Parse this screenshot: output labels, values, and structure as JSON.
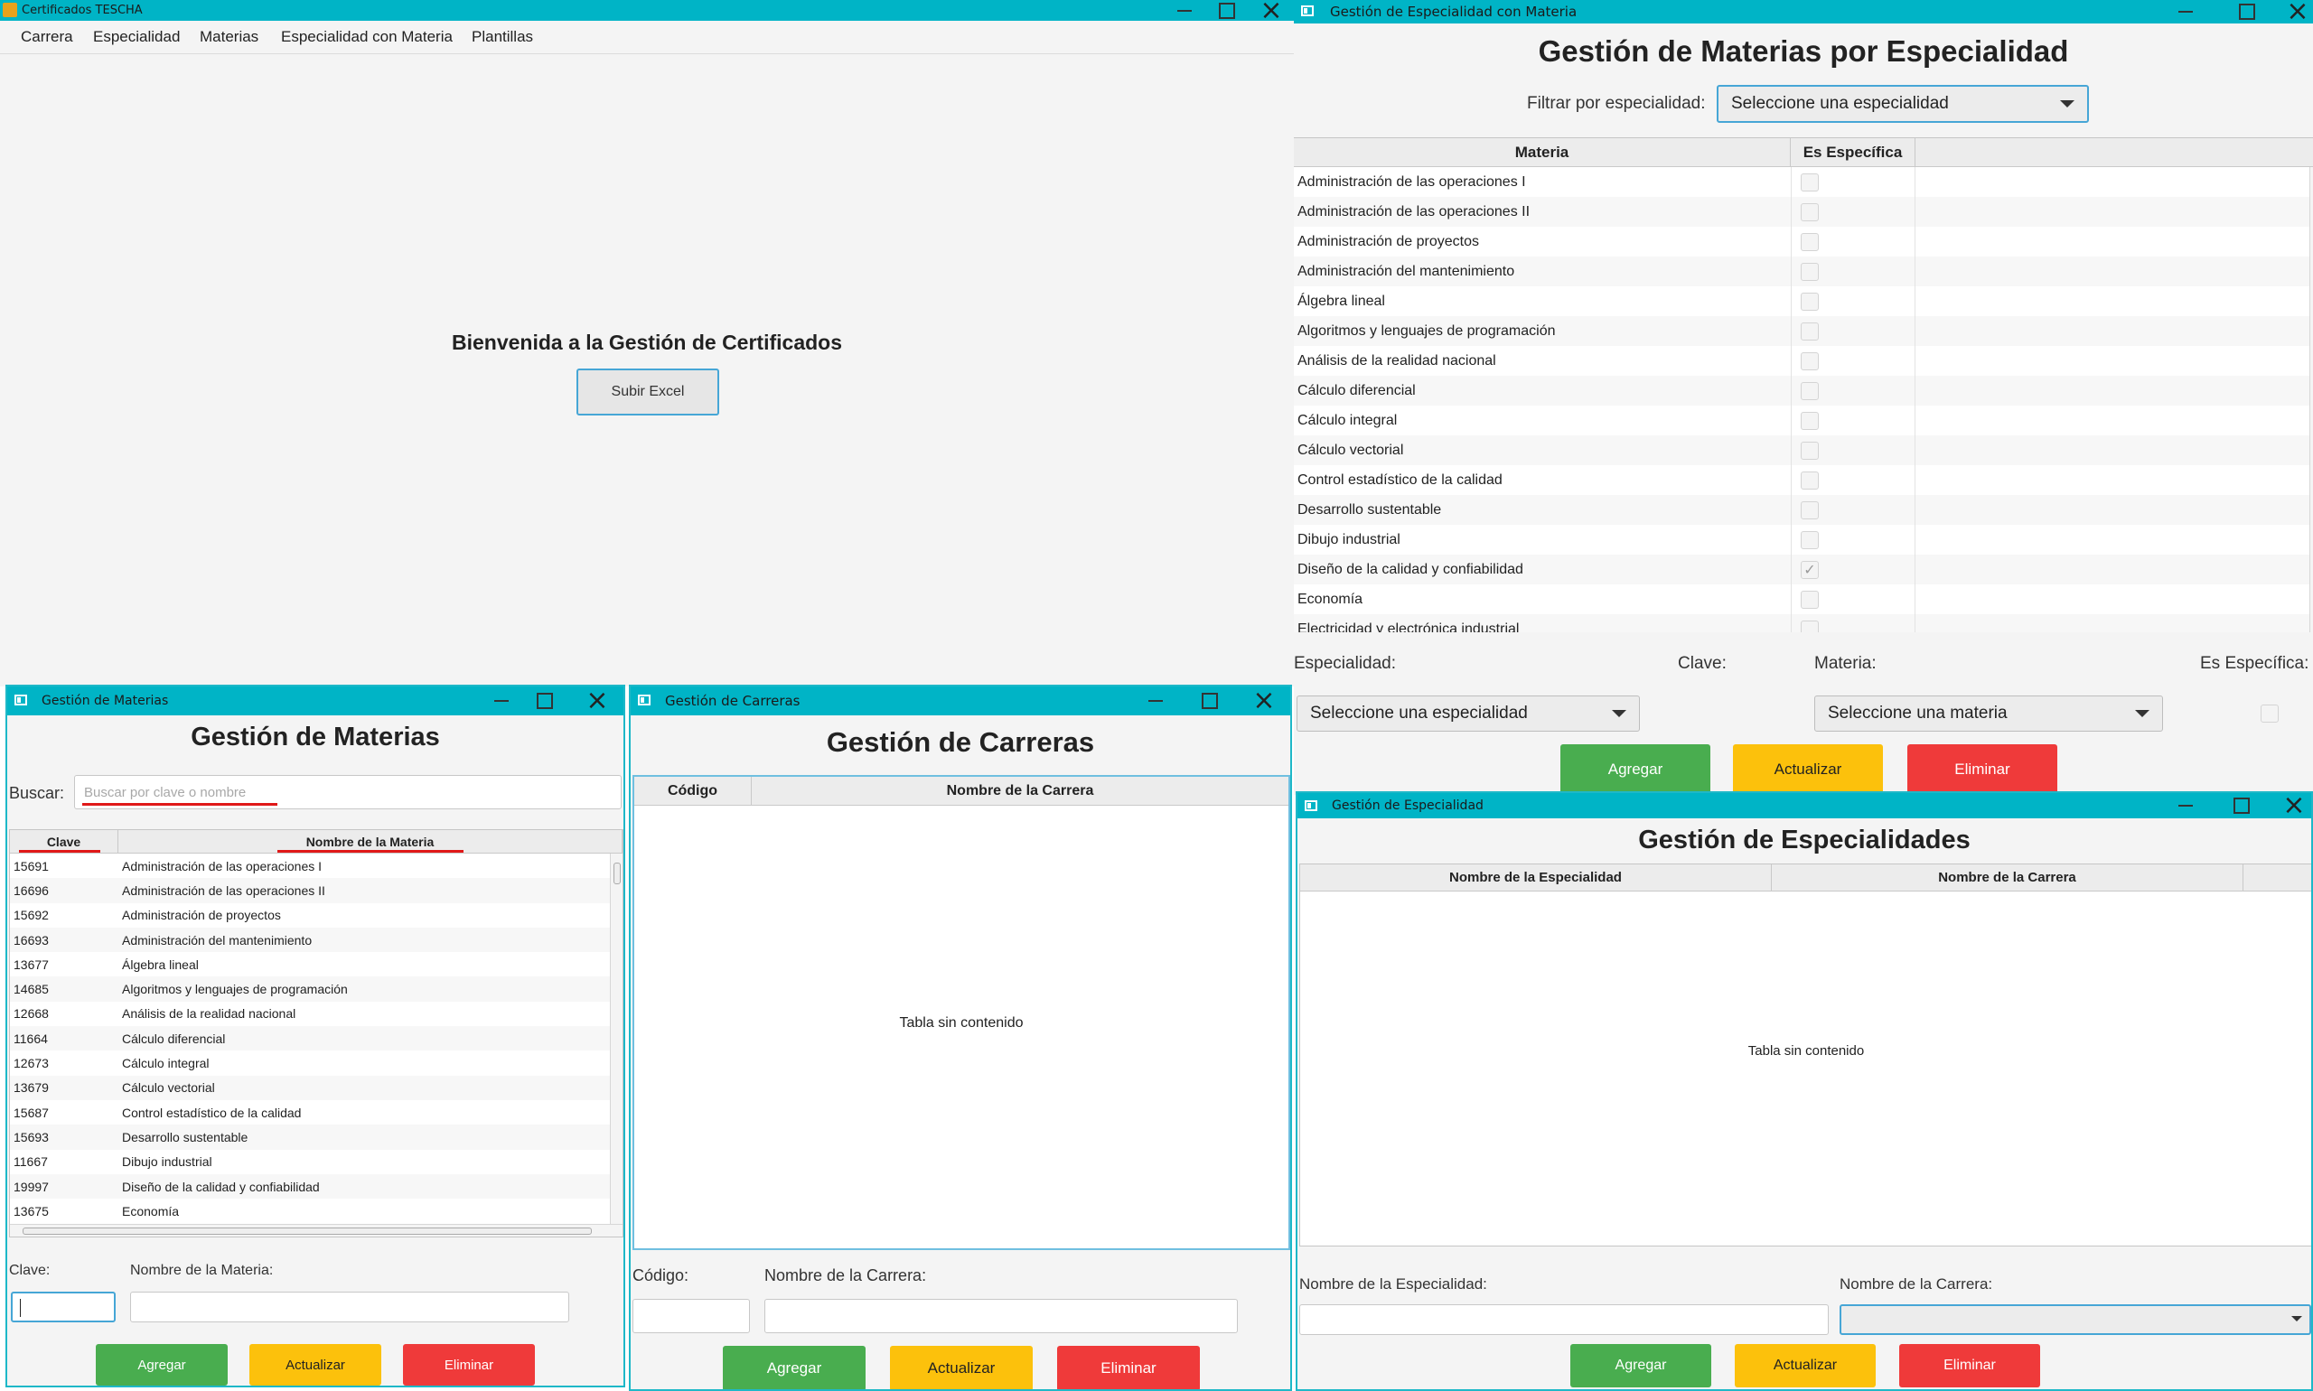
{
  "main": {
    "title": "Certificados TESCHA",
    "menu": [
      "Carrera",
      "Especialidad",
      "Materias",
      "Especialidad con Materia",
      "Plantillas"
    ],
    "welcome": "Bienvenida a la Gestión de Certificados",
    "upload_btn": "Subir Excel"
  },
  "esp_mat": {
    "title": "Gestión de Especialidad con Materia",
    "heading": "Gestión de Materias por Especialidad",
    "filter_label": "Filtrar por especialidad:",
    "filter_value": "Seleccione una especialidad",
    "columns": [
      "Materia",
      "Es Específica"
    ],
    "rows": [
      {
        "materia": "Administración de las operaciones I",
        "checked": false
      },
      {
        "materia": "Administración de las operaciones II",
        "checked": false
      },
      {
        "materia": "Administración de proyectos",
        "checked": false
      },
      {
        "materia": "Administración del mantenimiento",
        "checked": false
      },
      {
        "materia": "Álgebra lineal",
        "checked": false
      },
      {
        "materia": "Algoritmos y lenguajes de programación",
        "checked": false
      },
      {
        "materia": "Análisis de la realidad nacional",
        "checked": false
      },
      {
        "materia": "Cálculo diferencial",
        "checked": false
      },
      {
        "materia": "Cálculo integral",
        "checked": false
      },
      {
        "materia": "Cálculo vectorial",
        "checked": false
      },
      {
        "materia": "Control estadístico de la calidad",
        "checked": false
      },
      {
        "materia": "Desarrollo sustentable",
        "checked": false
      },
      {
        "materia": "Dibujo industrial",
        "checked": false
      },
      {
        "materia": "Diseño de la calidad y confiabilidad",
        "checked": true
      },
      {
        "materia": "Economía",
        "checked": false
      },
      {
        "materia": "Electricidad y electrónica industrial",
        "checked": false
      }
    ],
    "lbl_especialidad": "Especialidad:",
    "lbl_clave": "Clave:",
    "lbl_materia": "Materia:",
    "lbl_especifica": "Es Específica:",
    "combo_especialidad": "Seleccione una especialidad",
    "combo_materia": "Seleccione una materia",
    "btn_add": "Agregar",
    "btn_update": "Actualizar",
    "btn_delete": "Eliminar"
  },
  "materias": {
    "title": "Gestión de Materias",
    "heading": "Gestión de Materias",
    "search_label": "Buscar:",
    "search_placeholder": "Buscar por clave o nombre",
    "columns": [
      "Clave",
      "Nombre de la Materia"
    ],
    "rows": [
      {
        "clave": "15691",
        "nombre": "Administración de las operaciones I"
      },
      {
        "clave": "16696",
        "nombre": "Administración de las operaciones II"
      },
      {
        "clave": "15692",
        "nombre": "Administración de proyectos"
      },
      {
        "clave": "16693",
        "nombre": "Administración del mantenimiento"
      },
      {
        "clave": "13677",
        "nombre": "Álgebra lineal"
      },
      {
        "clave": "14685",
        "nombre": "Algoritmos y lenguajes de programación"
      },
      {
        "clave": "12668",
        "nombre": "Análisis de la realidad nacional"
      },
      {
        "clave": "11664",
        "nombre": "Cálculo diferencial"
      },
      {
        "clave": "12673",
        "nombre": "Cálculo integral"
      },
      {
        "clave": "13679",
        "nombre": "Cálculo vectorial"
      },
      {
        "clave": "15687",
        "nombre": "Control estadístico de la calidad"
      },
      {
        "clave": "15693",
        "nombre": "Desarrollo sustentable"
      },
      {
        "clave": "11667",
        "nombre": "Dibujo industrial"
      },
      {
        "clave": "19997",
        "nombre": "Diseño de la calidad y confiabilidad"
      },
      {
        "clave": "13675",
        "nombre": "Economía"
      }
    ],
    "lbl_clave": "Clave:",
    "lbl_nombre": "Nombre de la Materia:",
    "btn_add": "Agregar",
    "btn_update": "Actualizar",
    "btn_delete": "Eliminar"
  },
  "carreras": {
    "title": "Gestión de Carreras",
    "heading": "Gestión de Carreras",
    "columns": [
      "Código",
      "Nombre de la Carrera"
    ],
    "empty": "Tabla sin contenido",
    "lbl_codigo": "Código:",
    "lbl_nombre": "Nombre de la Carrera:",
    "btn_add": "Agregar",
    "btn_update": "Actualizar",
    "btn_delete": "Eliminar"
  },
  "especialidad": {
    "title": "Gestión de Especialidad",
    "heading": "Gestión de Especialidades",
    "columns": [
      "Nombre de la Especialidad",
      "Nombre de la Carrera"
    ],
    "empty": "Tabla sin contenido",
    "lbl_especialidad": "Nombre de la Especialidad:",
    "lbl_carrera": "Nombre de la Carrera:",
    "btn_add": "Agregar",
    "btn_update": "Actualizar",
    "btn_delete": "Eliminar"
  },
  "colors": {
    "titlebar": "#00b4c6",
    "green": "#49ad4f",
    "yellow": "#fcc10c",
    "red": "#ef3a3a",
    "underline": "#e01818"
  }
}
